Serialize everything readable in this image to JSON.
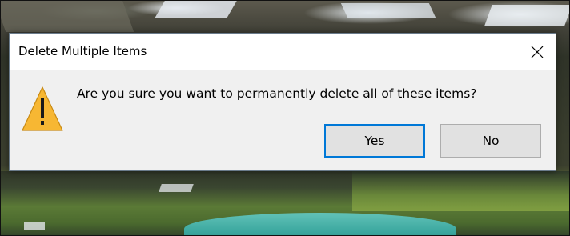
{
  "dialog": {
    "title": "Delete Multiple Items",
    "message": "Are you sure you want to permanently delete all of these items?",
    "icon": "warning-icon",
    "close_icon": "close-icon",
    "buttons": {
      "yes_label": "Yes",
      "no_label": "No",
      "default": "yes"
    }
  },
  "colors": {
    "dialog_background": "#f0f0f0",
    "titlebar_background": "#ffffff",
    "default_button_border": "#0078d7",
    "warning_fill": "#f7b733"
  }
}
